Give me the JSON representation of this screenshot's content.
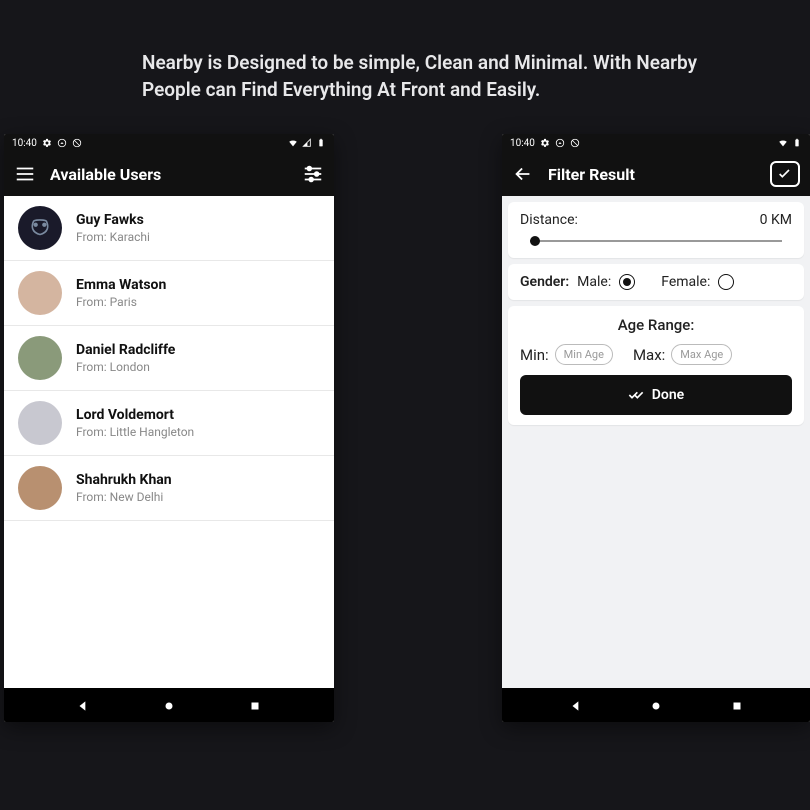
{
  "headline": "Nearby is Designed to be simple, Clean and Minimal. With Nearby People can Find Everything At Front and Easily.",
  "statusbar": {
    "time": "10:40"
  },
  "screenA": {
    "title": "Available Users",
    "users": [
      {
        "name": "Guy Fawks",
        "from": "From: Karachi"
      },
      {
        "name": "Emma Watson",
        "from": "From: Paris"
      },
      {
        "name": "Daniel Radcliffe",
        "from": "From: London"
      },
      {
        "name": "Lord Voldemort",
        "from": "From: Little Hangleton"
      },
      {
        "name": "Shahrukh Khan",
        "from": "From: New Delhi"
      }
    ]
  },
  "screenB": {
    "title": "Filter Result",
    "distance": {
      "label": "Distance:",
      "value": "0 KM"
    },
    "gender": {
      "label": "Gender:",
      "male_label": "Male:",
      "female_label": "Female:",
      "selected": "male"
    },
    "age": {
      "title": "Age Range:",
      "min_label": "Min:",
      "max_label": "Max:",
      "min_placeholder": "Min Age",
      "max_placeholder": "Max Age"
    },
    "done_label": "Done"
  }
}
